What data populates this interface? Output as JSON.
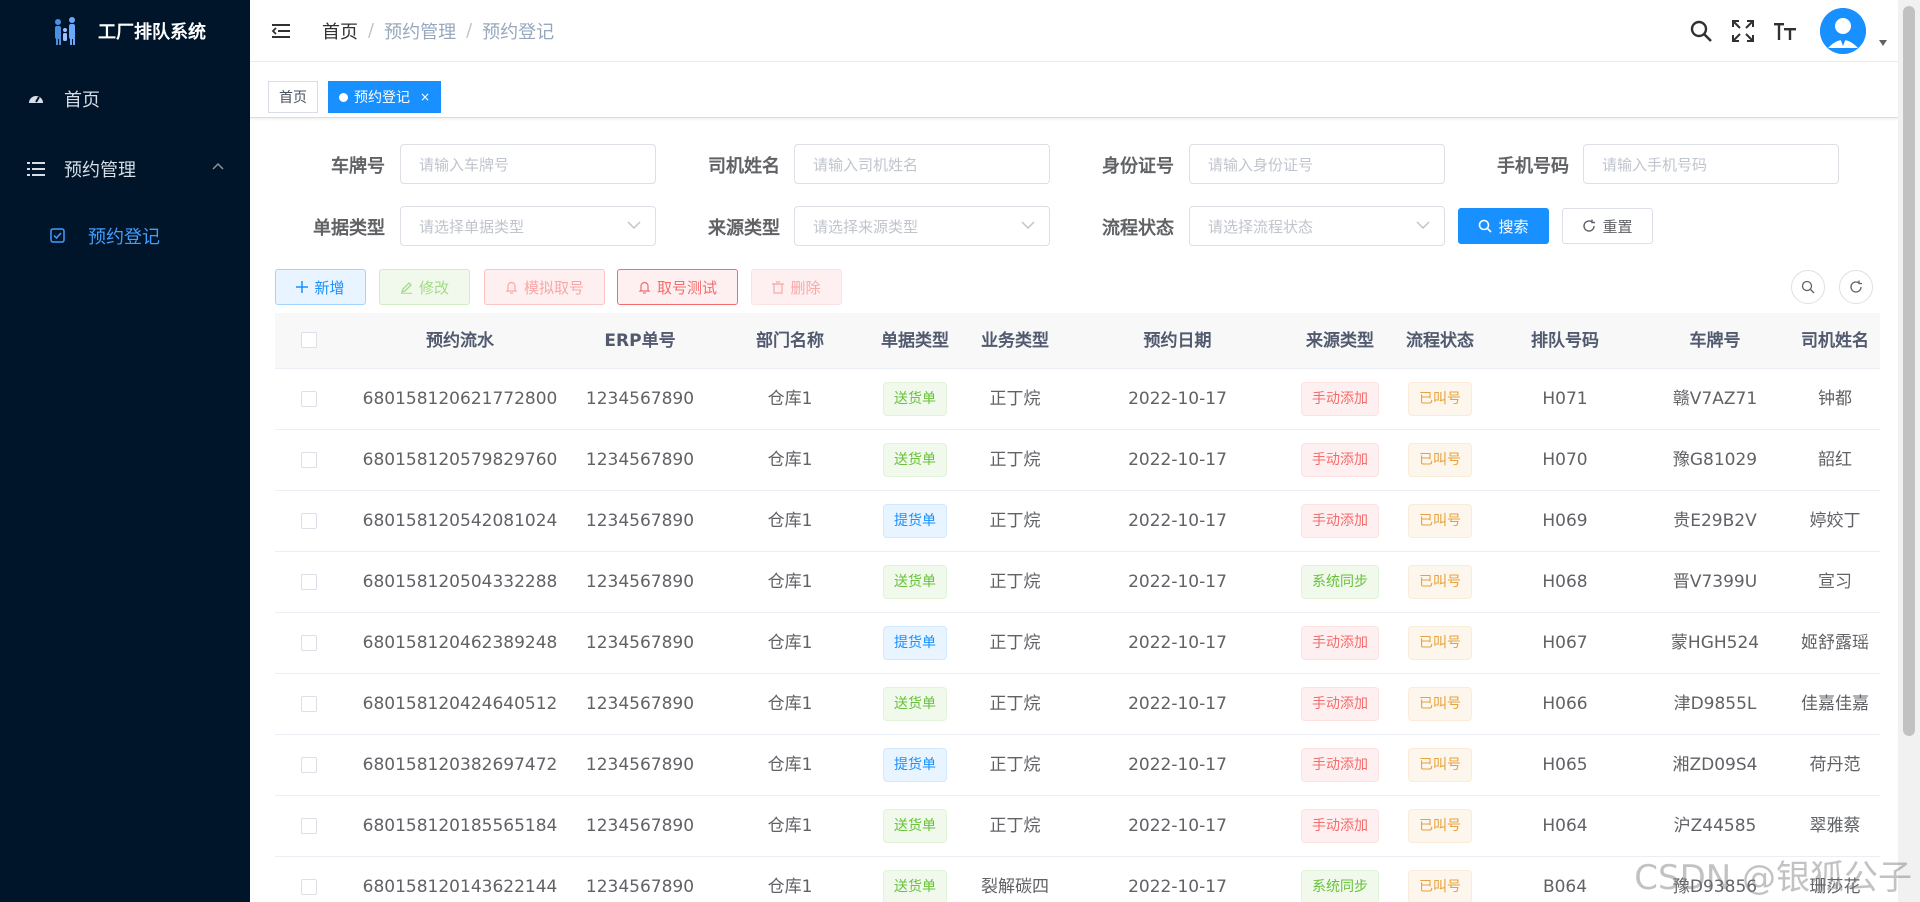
{
  "app_title": "工厂排队系统",
  "sidebar": {
    "items": [
      {
        "label": "首页",
        "icon": "dashboard-icon"
      },
      {
        "label": "预约管理",
        "icon": "list-icon",
        "expanded": true,
        "children": [
          {
            "label": "预约登记",
            "icon": "checkbox-icon",
            "active": true
          }
        ]
      }
    ]
  },
  "breadcrumb": [
    "首页",
    "预约管理",
    "预约登记"
  ],
  "tags": [
    {
      "label": "首页",
      "active": false
    },
    {
      "label": "预约登记",
      "active": true,
      "close": "×"
    }
  ],
  "filters": {
    "plate": {
      "label": "车牌号",
      "placeholder": "请输入车牌号"
    },
    "driver": {
      "label": "司机姓名",
      "placeholder": "请输入司机姓名"
    },
    "idcard": {
      "label": "身份证号",
      "placeholder": "请输入身份证号"
    },
    "phone": {
      "label": "手机号码",
      "placeholder": "请输入手机号码"
    },
    "doctype": {
      "label": "单据类型",
      "placeholder": "请选择单据类型"
    },
    "source": {
      "label": "来源类型",
      "placeholder": "请选择来源类型"
    },
    "flow": {
      "label": "流程状态",
      "placeholder": "请选择流程状态"
    },
    "search_label": "搜索",
    "reset_label": "重置"
  },
  "toolbar": {
    "add": "新增",
    "edit": "修改",
    "simulate": "模拟取号",
    "take_test": "取号测试",
    "delete": "删除"
  },
  "table": {
    "headers": [
      "预约流水",
      "ERP单号",
      "部门名称",
      "单据类型",
      "业务类型",
      "预约日期",
      "来源类型",
      "流程状态",
      "排队号码",
      "车牌号",
      "司机姓名"
    ],
    "rows": [
      {
        "serial": "680158120621772800",
        "erp": "1234567890",
        "dept": "仓库1",
        "doc": "送货单",
        "doc_color": "green",
        "biz": "正丁烷",
        "date": "2022-10-17",
        "source": "手动添加",
        "source_color": "red",
        "flow": "已叫号",
        "queue": "H071",
        "plate": "赣V7AZ71",
        "driver": "钟都"
      },
      {
        "serial": "680158120579829760",
        "erp": "1234567890",
        "dept": "仓库1",
        "doc": "送货单",
        "doc_color": "green",
        "biz": "正丁烷",
        "date": "2022-10-17",
        "source": "手动添加",
        "source_color": "red",
        "flow": "已叫号",
        "queue": "H070",
        "plate": "豫G81029",
        "driver": "韶红"
      },
      {
        "serial": "680158120542081024",
        "erp": "1234567890",
        "dept": "仓库1",
        "doc": "提货单",
        "doc_color": "blue",
        "biz": "正丁烷",
        "date": "2022-10-17",
        "source": "手动添加",
        "source_color": "red",
        "flow": "已叫号",
        "queue": "H069",
        "plate": "贵E29B2V",
        "driver": "婷姣丁"
      },
      {
        "serial": "680158120504332288",
        "erp": "1234567890",
        "dept": "仓库1",
        "doc": "送货单",
        "doc_color": "green",
        "biz": "正丁烷",
        "date": "2022-10-17",
        "source": "系统同步",
        "source_color": "green",
        "flow": "已叫号",
        "queue": "H068",
        "plate": "晋V7399U",
        "driver": "宣习"
      },
      {
        "serial": "680158120462389248",
        "erp": "1234567890",
        "dept": "仓库1",
        "doc": "提货单",
        "doc_color": "blue",
        "biz": "正丁烷",
        "date": "2022-10-17",
        "source": "手动添加",
        "source_color": "red",
        "flow": "已叫号",
        "queue": "H067",
        "plate": "蒙HGH524",
        "driver": "姬舒露瑶"
      },
      {
        "serial": "680158120424640512",
        "erp": "1234567890",
        "dept": "仓库1",
        "doc": "送货单",
        "doc_color": "green",
        "biz": "正丁烷",
        "date": "2022-10-17",
        "source": "手动添加",
        "source_color": "red",
        "flow": "已叫号",
        "queue": "H066",
        "plate": "津D9855L",
        "driver": "佳嘉佳嘉"
      },
      {
        "serial": "680158120382697472",
        "erp": "1234567890",
        "dept": "仓库1",
        "doc": "提货单",
        "doc_color": "blue",
        "biz": "正丁烷",
        "date": "2022-10-17",
        "source": "手动添加",
        "source_color": "red",
        "flow": "已叫号",
        "queue": "H065",
        "plate": "湘ZD09S4",
        "driver": "荷丹范"
      },
      {
        "serial": "680158120185565184",
        "erp": "1234567890",
        "dept": "仓库1",
        "doc": "送货单",
        "doc_color": "green",
        "biz": "正丁烷",
        "date": "2022-10-17",
        "source": "手动添加",
        "source_color": "red",
        "flow": "已叫号",
        "queue": "H064",
        "plate": "沪Z44585",
        "driver": "翠雅蔡"
      },
      {
        "serial": "680158120143622144",
        "erp": "1234567890",
        "dept": "仓库1",
        "doc": "送货单",
        "doc_color": "green",
        "biz": "裂解碳四",
        "date": "2022-10-17",
        "source": "系统同步",
        "source_color": "green",
        "flow": "已叫号",
        "queue": "B064",
        "plate": "豫D93856",
        "driver": "珊莎花"
      }
    ]
  },
  "watermark": "CSDN @银狐公子",
  "colors": {
    "sidebar_bg": "#001529",
    "primary": "#1890ff",
    "danger": "#f56c6c",
    "success": "#67c23a",
    "warning": "#e6a23c"
  }
}
